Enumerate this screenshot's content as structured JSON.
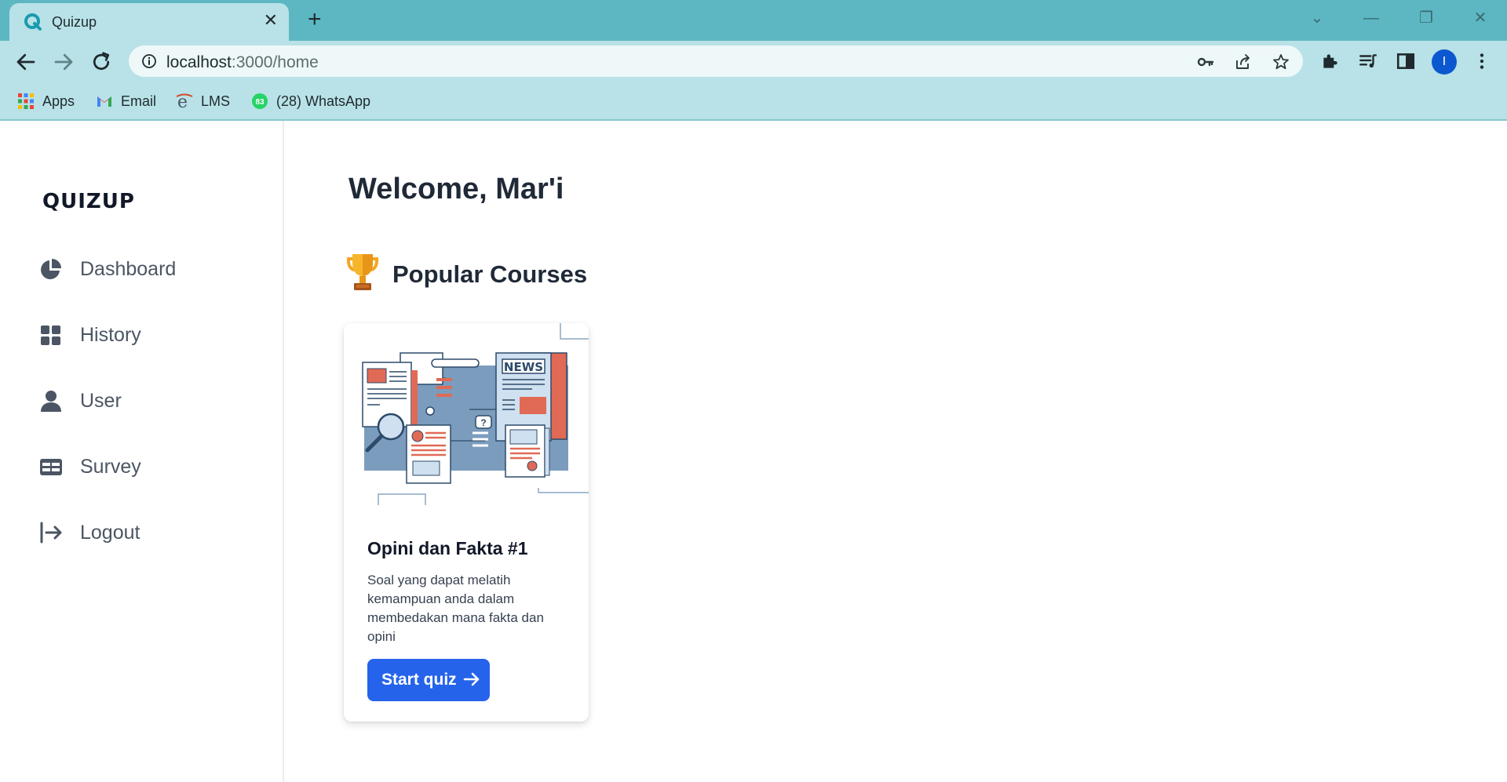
{
  "browser": {
    "tab_title": "Quizup",
    "url_host": "localhost",
    "url_path": ":3000/home",
    "bookmarks": [
      {
        "label": "Apps",
        "icon": "apps-grid-icon"
      },
      {
        "label": "Email",
        "icon": "gmail-icon"
      },
      {
        "label": "LMS",
        "icon": "lms-icon"
      },
      {
        "label": "(28) WhatsApp",
        "icon": "whatsapp-icon",
        "badge": "83"
      }
    ],
    "profile_initial": "I",
    "accent_color": "#5db7c2"
  },
  "sidebar": {
    "brand": "QUIZUP",
    "items": [
      {
        "label": "Dashboard",
        "icon": "pie-chart-icon"
      },
      {
        "label": "History",
        "icon": "grid-icon"
      },
      {
        "label": "User",
        "icon": "user-icon"
      },
      {
        "label": "Survey",
        "icon": "table-icon"
      },
      {
        "label": "Logout",
        "icon": "logout-icon"
      }
    ]
  },
  "main": {
    "welcome": "Welcome, Mar'i",
    "section_title": "Popular Courses",
    "section_icon": "trophy-icon",
    "courses": [
      {
        "title": "Opini dan Fakta #1",
        "description": "Soal yang dapat melatih kemampuan anda dalam membedakan mana fakta dan opini",
        "button_label": "Start quiz",
        "illustration_text": "NEWS",
        "button_color": "#2563eb"
      }
    ]
  }
}
